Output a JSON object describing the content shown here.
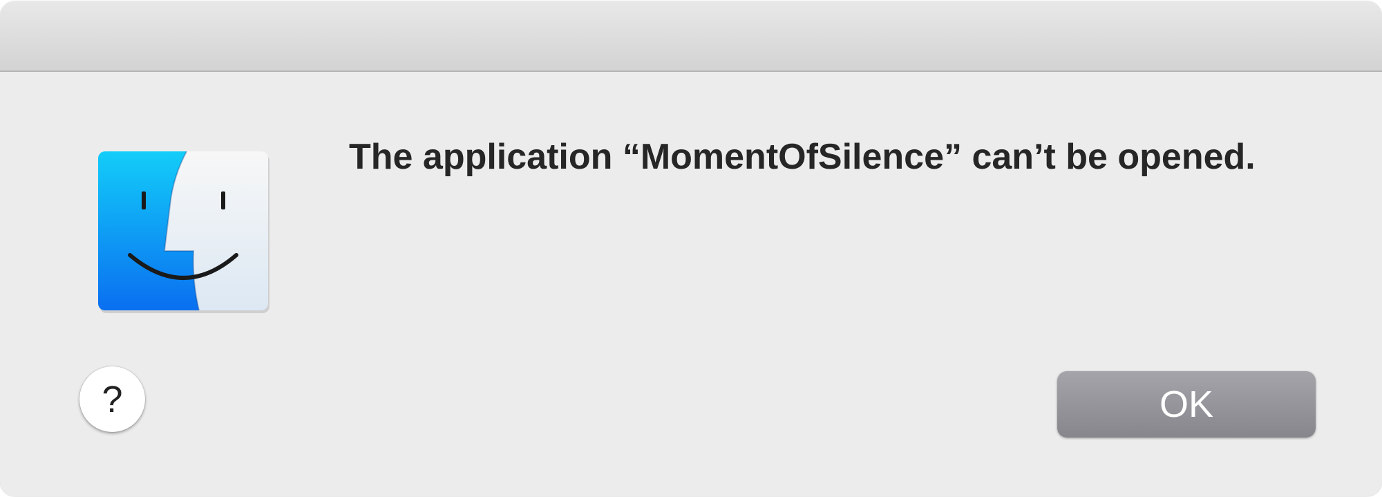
{
  "dialog": {
    "message": "The application “MomentOfSilence” can’t be opened.",
    "icon": "finder-icon",
    "help_label": "?",
    "ok_label": "OK"
  }
}
